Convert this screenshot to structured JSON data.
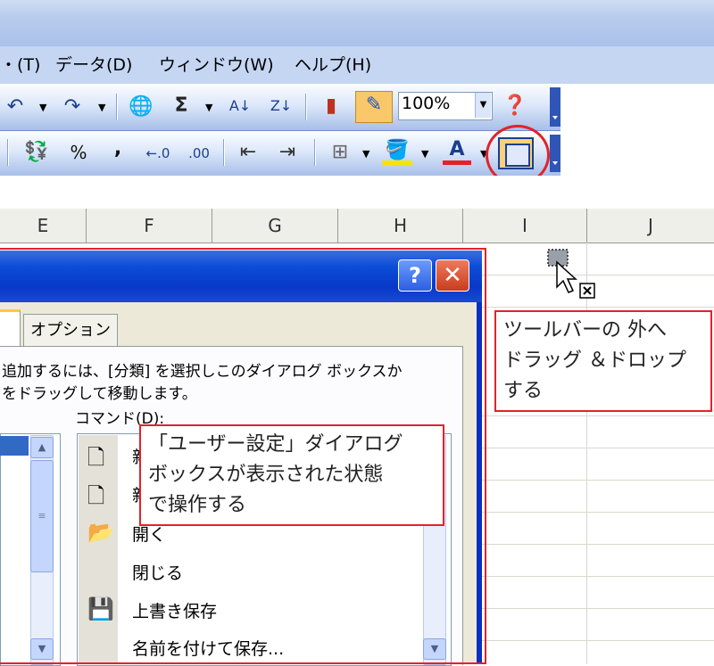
{
  "menu": {
    "items": [
      "・(T)",
      "データ(D)",
      "ウィンドウ(W)",
      "ヘルプ(H)"
    ]
  },
  "toolbar": {
    "zoom_value": "100%",
    "icons": [
      "undo-icon",
      "redo-icon",
      "hyperlink-icon",
      "autosum-icon",
      "sort-asc-icon",
      "sort-desc-icon",
      "chart-wizard-icon",
      "drawing-icon",
      "help-icon"
    ],
    "format_icons": [
      "currency-icon",
      "percent-icon",
      "comma-icon",
      "increase-decimal-icon",
      "decrease-decimal-icon",
      "decrease-indent-icon",
      "increase-indent-icon",
      "borders-icon",
      "fill-color-icon",
      "font-color-icon",
      "custom-button-icon"
    ]
  },
  "grid": {
    "columns": [
      "E",
      "F",
      "G",
      "H",
      "I",
      "J"
    ]
  },
  "dialog": {
    "tab_options": "オプション",
    "instruction_line1": "追加するには、[分類] を選択しこのダイアログ ボックスか",
    "instruction_line2": "をドラッグして移動します。",
    "commands_label": "コマンド(D):",
    "commands": [
      "新",
      "新",
      "開く",
      "閉じる",
      "上書き保存",
      "名前を付けて保存..."
    ],
    "help_glyph": "?",
    "close_glyph": "✕"
  },
  "annotations": {
    "callout_right": [
      "ツールバーの 外へ",
      "ドラッグ ＆ドロップ",
      "する"
    ],
    "callout_center": [
      "「ユーザー設定」ダイアログ",
      "ボックスが表示された状態",
      "で操作する"
    ]
  },
  "colors": {
    "accent_red": "#e0232b",
    "xp_blue": "#0a2fc4"
  }
}
